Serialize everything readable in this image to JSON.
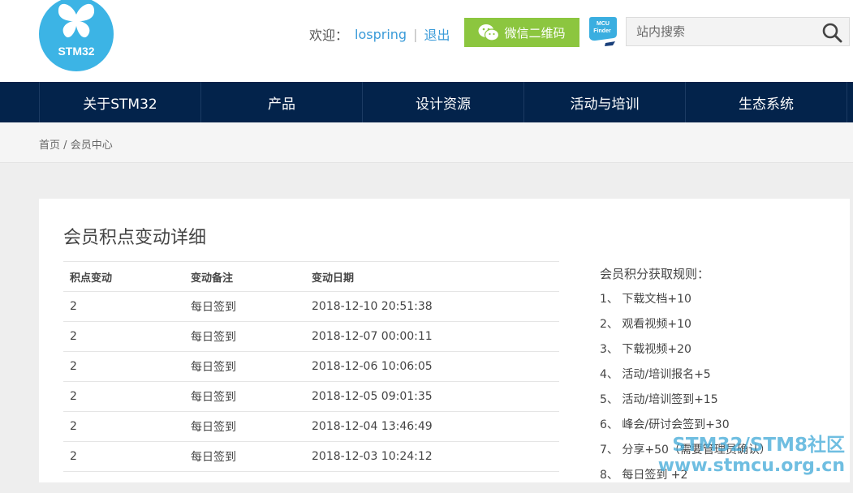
{
  "header": {
    "logo_text": "STM32",
    "welcome_label": "欢迎：",
    "username": "lospring",
    "separator": "|",
    "logout": "退出",
    "wechat_button": "微信二维码",
    "mcu_finder_line1": "MCU",
    "mcu_finder_line2": "Finder",
    "search": {
      "placeholder": "站内搜索",
      "value": ""
    }
  },
  "nav": {
    "items": [
      {
        "label": "关于STM32"
      },
      {
        "label": "产品"
      },
      {
        "label": "设计资源"
      },
      {
        "label": "活动与培训"
      },
      {
        "label": "生态系统"
      }
    ]
  },
  "breadcrumb": {
    "home": "首页",
    "separator": "/",
    "current": "会员中心"
  },
  "main": {
    "title": "会员积点变动详细",
    "table": {
      "headers": [
        "积点变动",
        "变动备注",
        "变动日期"
      ],
      "rows": [
        [
          "2",
          "每日签到",
          "2018-12-10 20:51:38"
        ],
        [
          "2",
          "每日签到",
          "2018-12-07 00:00:11"
        ],
        [
          "2",
          "每日签到",
          "2018-12-06 10:06:05"
        ],
        [
          "2",
          "每日签到",
          "2018-12-05 09:01:35"
        ],
        [
          "2",
          "每日签到",
          "2018-12-04 13:46:49"
        ],
        [
          "2",
          "每日签到",
          "2018-12-03 10:24:12"
        ]
      ]
    },
    "rules": {
      "title": "会员积分获取规则：",
      "items": [
        "1、 下载文档+10",
        "2、 观看视频+10",
        "3、 下载视频+20",
        "4、 活动/培训报名+5",
        "5、 活动/培训签到+15",
        "6、 峰会/研讨会签到+30",
        "7、 分享+50（需要管理员确认）",
        "8、 每日签到 +2"
      ]
    }
  },
  "watermark": {
    "line1": "STM32/STM8社区",
    "line2": "www.stmcu.org.cn"
  },
  "colors": {
    "nav_bg": "#03234b",
    "logo_bg": "#3cb4e5",
    "wechat_green": "#8cc63f",
    "link_blue": "#3a9bd9"
  }
}
